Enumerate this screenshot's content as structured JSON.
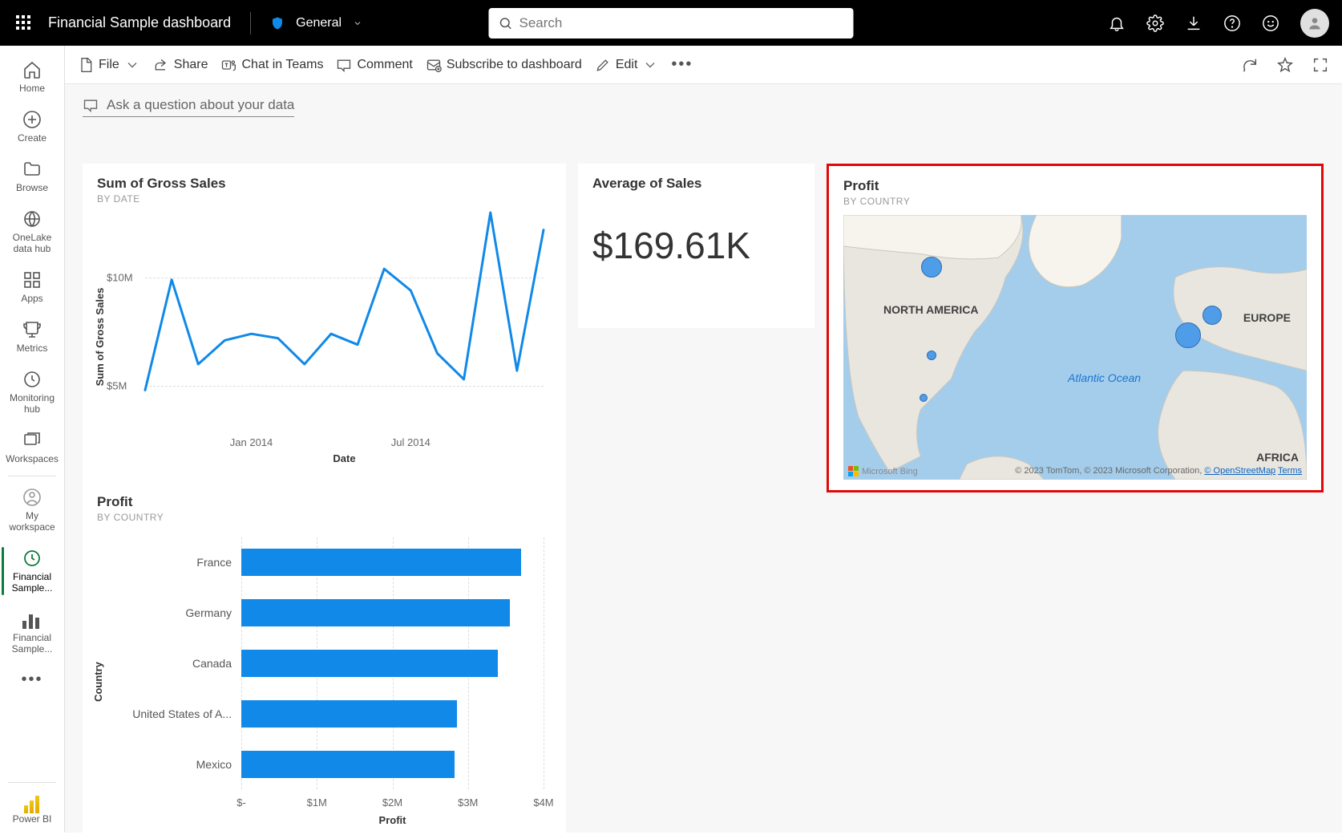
{
  "header": {
    "doc_title": "Financial Sample dashboard",
    "sensitivity": "General",
    "search_placeholder": "Search"
  },
  "leftrail": {
    "items": [
      {
        "id": "home",
        "label": "Home"
      },
      {
        "id": "create",
        "label": "Create"
      },
      {
        "id": "browse",
        "label": "Browse"
      },
      {
        "id": "onelake",
        "label": "OneLake data hub"
      },
      {
        "id": "apps",
        "label": "Apps"
      },
      {
        "id": "metrics",
        "label": "Metrics"
      },
      {
        "id": "monitoring",
        "label": "Monitoring hub"
      },
      {
        "id": "workspaces",
        "label": "Workspaces"
      },
      {
        "id": "myws",
        "label": "My workspace"
      },
      {
        "id": "fs1",
        "label": "Financial Sample..."
      },
      {
        "id": "fs2",
        "label": "Financial Sample..."
      }
    ],
    "footer": "Power BI"
  },
  "cmdbar": {
    "file": "File",
    "share": "Share",
    "chat": "Chat in Teams",
    "comment": "Comment",
    "subscribe": "Subscribe to dashboard",
    "edit": "Edit"
  },
  "qna": "Ask a question about your data",
  "tile_line": {
    "title": "Sum of Gross Sales",
    "subtitle": "BY DATE",
    "ylabel": "Sum of Gross Sales",
    "xlabel": "Date",
    "yticks": [
      "$5M",
      "$10M"
    ],
    "xticks": [
      "Jan 2014",
      "Jul 2014"
    ]
  },
  "tile_card": {
    "title": "Average of Sales",
    "value": "$169.61K"
  },
  "tile_map": {
    "title": "Profit",
    "subtitle": "BY COUNTRY",
    "labels": {
      "na": "NORTH AMERICA",
      "eu": "EUROPE",
      "af": "AFRICA",
      "ocean": "Atlantic Ocean"
    },
    "credit_bing": "Microsoft Bing",
    "credit_text": "© 2023 TomTom, © 2023 Microsoft Corporation,",
    "credit_osm": "© OpenStreetMap",
    "credit_terms": "Terms"
  },
  "tile_bar": {
    "title": "Profit",
    "subtitle": "BY COUNTRY",
    "ylabel": "Country",
    "xlabel": "Profit",
    "xticks": [
      "$-",
      "$1M",
      "$2M",
      "$3M",
      "$4M"
    ]
  },
  "chart_data": [
    {
      "type": "line",
      "title": "Sum of Gross Sales",
      "xlabel": "Date",
      "ylabel": "Sum of Gross Sales",
      "ylim": [
        3000000,
        13000000
      ],
      "x": [
        "2013-09",
        "2013-10",
        "2013-11",
        "2013-12",
        "2014-01",
        "2014-02",
        "2014-03",
        "2014-04",
        "2014-05",
        "2014-06",
        "2014-07",
        "2014-08",
        "2014-09",
        "2014-10",
        "2014-11",
        "2014-12"
      ],
      "values": [
        4800000,
        9900000,
        6000000,
        7100000,
        7400000,
        7200000,
        6000000,
        7400000,
        6900000,
        10400000,
        9400000,
        6500000,
        5300000,
        13000000,
        5700000,
        12200000
      ]
    },
    {
      "type": "table",
      "title": "Average of Sales",
      "value": 169610
    },
    {
      "type": "map",
      "title": "Profit by Country",
      "series": [
        {
          "name": "Canada",
          "value": 3000000
        },
        {
          "name": "United States of America",
          "value": 700000
        },
        {
          "name": "Mexico",
          "value": 500000
        },
        {
          "name": "Germany",
          "value": 3400000
        },
        {
          "name": "France",
          "value": 3700000
        }
      ]
    },
    {
      "type": "bar",
      "title": "Profit",
      "ylabel": "Country",
      "xlabel": "Profit",
      "xlim": [
        0,
        4000000
      ],
      "categories": [
        "France",
        "Germany",
        "Canada",
        "United States of A...",
        "Mexico"
      ],
      "values": [
        3700000,
        3550000,
        3400000,
        2850000,
        2820000
      ]
    }
  ]
}
